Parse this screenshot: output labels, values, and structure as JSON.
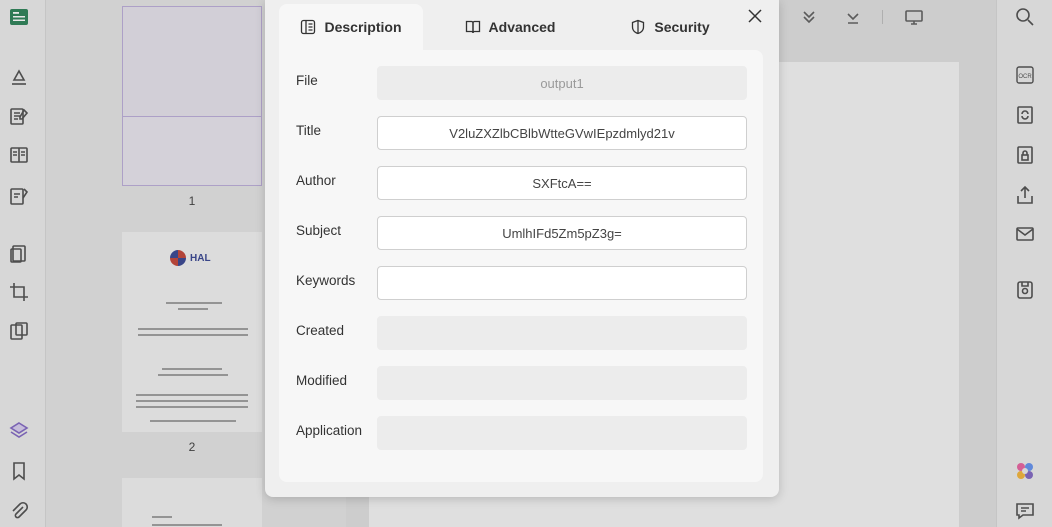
{
  "dialog": {
    "tabs": [
      {
        "label": "Description",
        "icon": "document-info-icon",
        "active": true
      },
      {
        "label": "Advanced",
        "icon": "book-icon",
        "active": false
      },
      {
        "label": "Security",
        "icon": "shield-icon",
        "active": false
      }
    ],
    "fields": [
      {
        "label": "File",
        "value": "output1",
        "editable": false
      },
      {
        "label": "Title",
        "value": "V2luZXZlbCBlbWtteGVwIEpzdmlyd21v",
        "editable": true
      },
      {
        "label": "Author",
        "value": "SXFtcA==",
        "editable": true
      },
      {
        "label": "Subject",
        "value": "UmlhIFd5Zm5pZ3g=",
        "editable": true
      },
      {
        "label": "Keywords",
        "value": "",
        "editable": true
      },
      {
        "label": "Created",
        "value": "",
        "editable": false
      },
      {
        "label": "Modified",
        "value": "",
        "editable": false
      },
      {
        "label": "Application",
        "value": "",
        "editable": false
      }
    ]
  },
  "thumbnails": {
    "page1_number": "1",
    "page2_number": "2",
    "hal_logo_text": "HAL"
  },
  "colors": {
    "accent": "#1f7a4d",
    "selection": "#b9a9d8"
  }
}
